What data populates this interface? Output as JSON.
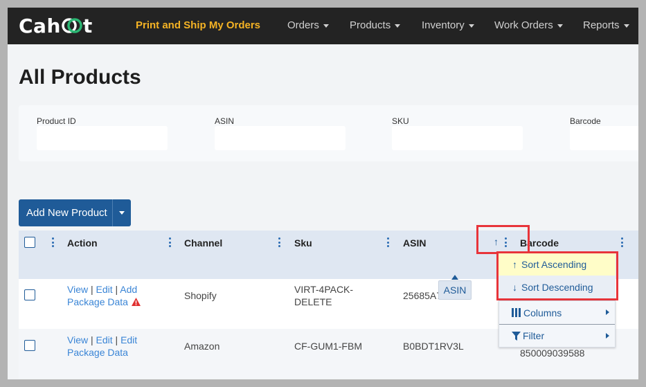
{
  "app": {
    "logo_text_left": "Cah",
    "logo_text_right": "t"
  },
  "nav": {
    "primary": "Print and Ship My Orders",
    "items": [
      "Orders",
      "Products",
      "Inventory",
      "Work Orders",
      "Reports"
    ]
  },
  "page": {
    "title": "All Products"
  },
  "filters": [
    {
      "label": "Product ID",
      "value": ""
    },
    {
      "label": "ASIN",
      "value": ""
    },
    {
      "label": "SKU",
      "value": ""
    },
    {
      "label": "Barcode",
      "value": ""
    }
  ],
  "toolbar": {
    "add_label": "Add New Product"
  },
  "grid": {
    "columns": [
      "Action",
      "Channel",
      "Sku",
      "ASIN",
      "Barcode"
    ],
    "rows": [
      {
        "actions": {
          "view": "View",
          "edit": "Edit",
          "third": "Add Package Data",
          "warning": true
        },
        "channel": "Shopify",
        "sku": "VIRT-4PACK-DELETE",
        "asin": "25685A7",
        "barcode": ""
      },
      {
        "actions": {
          "view": "View",
          "edit": "Edit",
          "third": "Edit Package Data",
          "warning": false
        },
        "channel": "Amazon",
        "sku": "CF-GUM1-FBM",
        "asin": "B0BDT1RV3L",
        "barcode": "850009039588"
      }
    ]
  },
  "column_menu": {
    "sort_ascending": "Sort Ascending",
    "sort_descending": "Sort Descending",
    "columns": "Columns",
    "filter": "Filter",
    "sort_indicator": "↑"
  },
  "tooltip": {
    "text": "ASIN"
  },
  "colors": {
    "nav_bg": "#232323",
    "accent_orange": "#f5b324",
    "logo_green": "#2bb673",
    "primary_blue": "#1f5b98",
    "link_blue": "#3a85d6",
    "highlight_red": "#e8343a",
    "menu_highlight": "#fffdc8"
  }
}
